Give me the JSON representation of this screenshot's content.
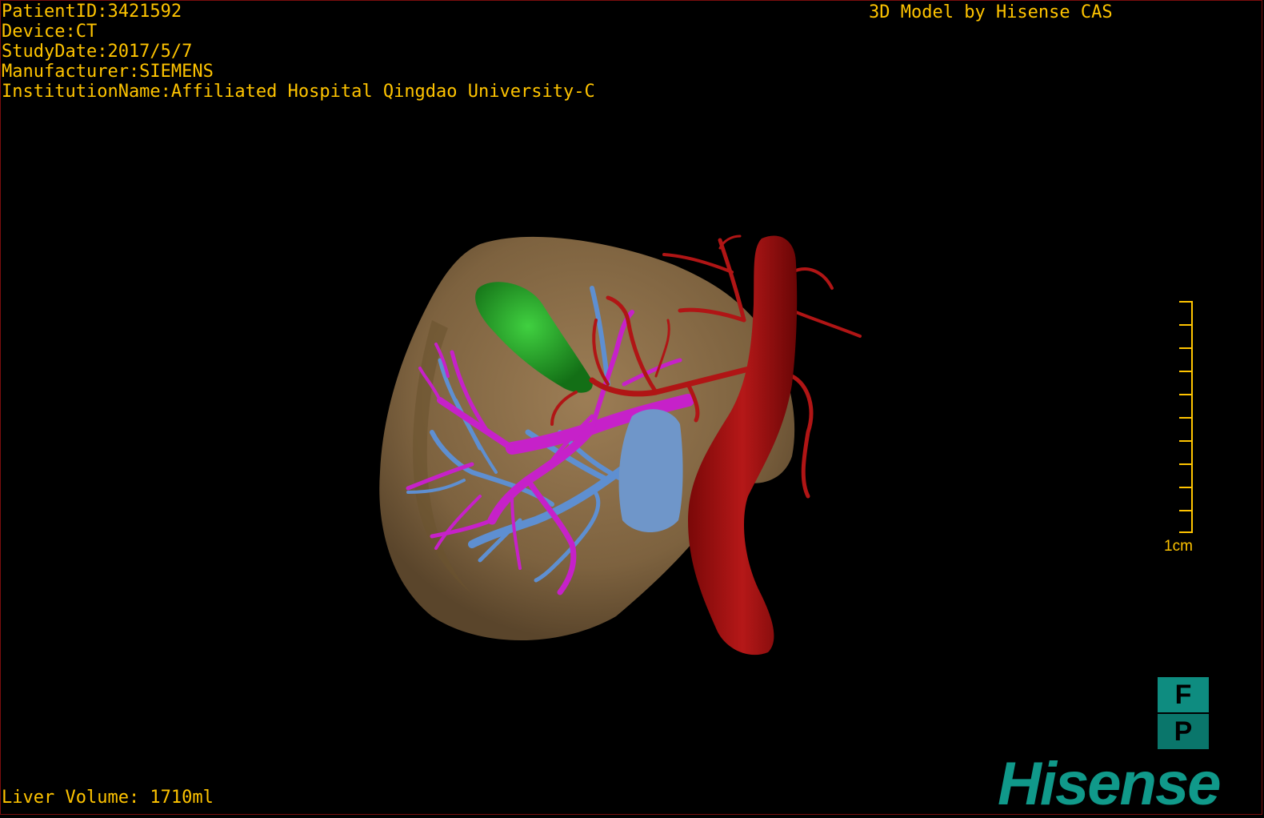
{
  "overlay": {
    "patient_id": "PatientID:3421592",
    "device": "Device:CT",
    "study_date": "StudyDate:2017/5/7",
    "manufacturer": "Manufacturer:SIEMENS",
    "institution": "InstitutionName:Affiliated Hospital Qingdao University-C",
    "brand_text": "3D Model by Hisense CAS",
    "liver_volume": "Liver Volume: 1710ml"
  },
  "scale_bar": {
    "label": "1cm",
    "color": "#ffc400"
  },
  "orientation_cube": {
    "face_top": "F",
    "face_bottom": "P"
  },
  "logo": {
    "text": "Hisense",
    "color": "#10998a"
  },
  "model_colors": {
    "liver": "#8a6d48",
    "gallbladder": "#22a12a",
    "hepatic_artery": "#b01515",
    "portal_vein": "#c621c9",
    "hepatic_vein": "#5e8fd1",
    "ivc": "#6f96c9"
  }
}
